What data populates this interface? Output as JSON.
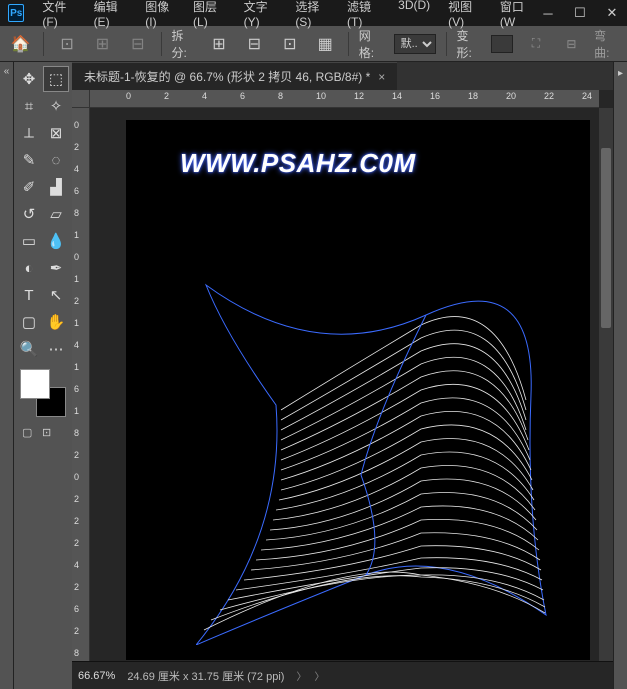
{
  "menubar": {
    "items": [
      {
        "label": "文件(F)"
      },
      {
        "label": "编辑(E)"
      },
      {
        "label": "图像(I)"
      },
      {
        "label": "图层(L)"
      },
      {
        "label": "文字(Y)"
      },
      {
        "label": "选择(S)"
      },
      {
        "label": "滤镜(T)"
      },
      {
        "label": "3D(D)"
      },
      {
        "label": "视图(V)"
      },
      {
        "label": "窗口(W"
      }
    ]
  },
  "options_bar": {
    "split_label": "拆分:",
    "grid_label": "网格:",
    "grid_value": "默...",
    "transform_label": "变形:",
    "warp_label": "弯曲:"
  },
  "document": {
    "tab_title": "未标题-1-恢复的 @ 66.7% (形状 2 拷贝 46, RGB/8#) *",
    "watermark": "WWW.PSAHZ.C0M"
  },
  "ruler_h": [
    "0",
    "2",
    "4",
    "6",
    "8",
    "10",
    "12",
    "14",
    "16",
    "18",
    "20",
    "22",
    "24"
  ],
  "ruler_v": [
    "0",
    "2",
    "4",
    "6",
    "8",
    "1",
    "0",
    "1",
    "2",
    "1",
    "4",
    "1",
    "6",
    "1",
    "8",
    "2",
    "0",
    "2",
    "2",
    "2",
    "4",
    "2",
    "6",
    "2",
    "8"
  ],
  "status": {
    "zoom": "66.67%",
    "dimensions": "24.69 厘米 x 31.75 厘米 (72 ppi)"
  },
  "colors": {
    "foreground": "#ffffff",
    "background": "#000000",
    "selection_outline": "#3b6bff"
  }
}
